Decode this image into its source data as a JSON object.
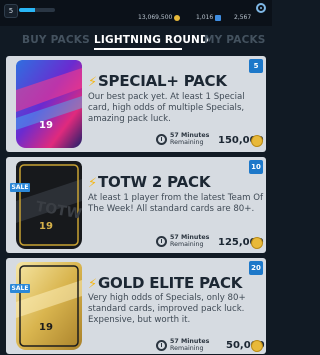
{
  "topbar": {
    "level": "5",
    "xp_progress": 0.45,
    "coins": "13,069,500",
    "fifa_points": "1,016",
    "pack_count": "2,567"
  },
  "tabs": [
    {
      "label": "BUY PACKS",
      "active": false
    },
    {
      "label": "LIGHTNING ROUND",
      "active": true
    },
    {
      "label": "MY PACKS",
      "active": false
    }
  ],
  "packs": [
    {
      "title": "SPECIAL+ PACK",
      "description": "Our best pack yet. At least 1 Special card, high odds of multiple Specials, amazing pack luck.",
      "timer_value": "57 Minutes",
      "timer_sub": "Remaining",
      "price": "150,000",
      "quantity": "5",
      "sale": "",
      "pack_number": "19"
    },
    {
      "title": "TOTW 2 PACK",
      "description": "At least 1 player from the latest Team Of The Week! All standard cards are 80+.",
      "timer_value": "57 Minutes",
      "timer_sub": "Remaining",
      "price": "125,000",
      "quantity": "10",
      "sale": "SALE",
      "pack_number": "19"
    },
    {
      "title": "GOLD ELITE PACK",
      "description": "Very high odds of Specials, only 80+ standard cards, improved pack luck. Expensive, but worth it.",
      "timer_value": "57 Minutes",
      "timer_sub": "Remaining",
      "price": "50,000",
      "quantity": "20",
      "sale": "SALE",
      "pack_number": "19"
    }
  ],
  "colors": {
    "accent_blue": "#1d78c9",
    "coin_gold": "#e8b93a",
    "bolt_yellow": "#f3b81e",
    "background": "#111a24"
  }
}
